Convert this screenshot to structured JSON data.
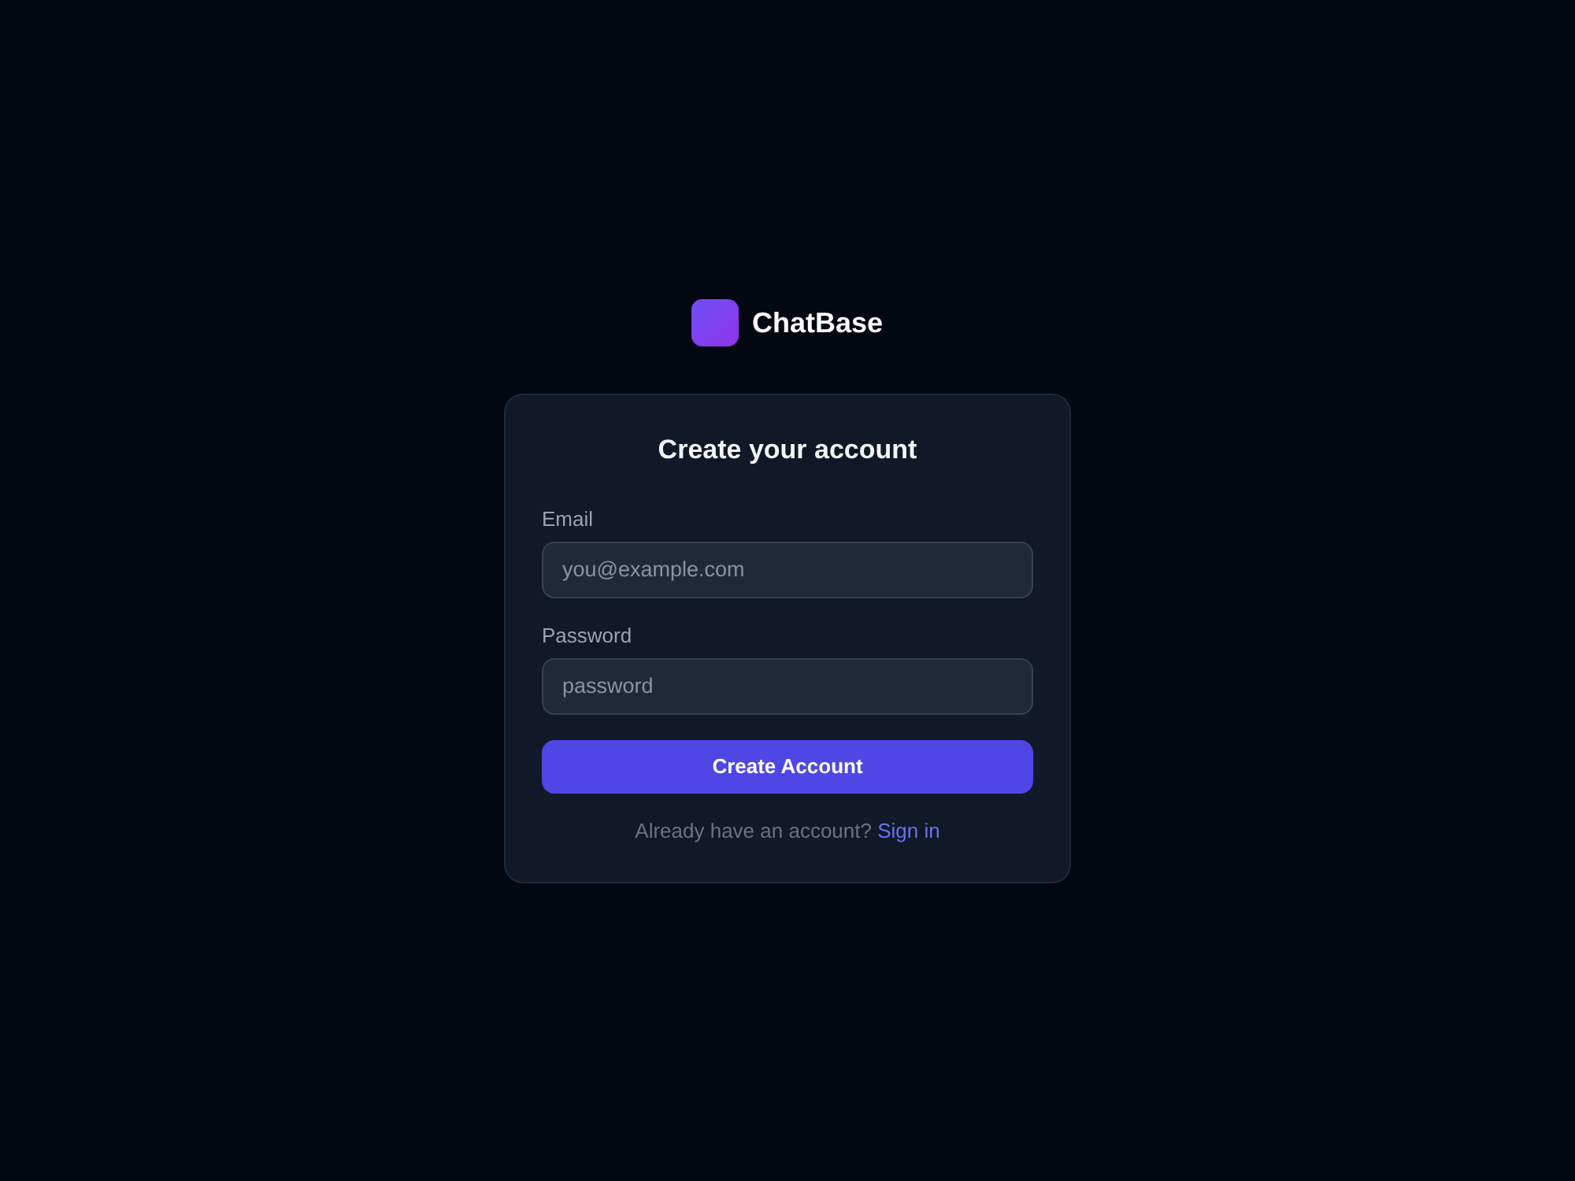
{
  "brand": {
    "name": "ChatBase"
  },
  "card": {
    "title": "Create your account"
  },
  "fields": [
    {
      "label": "Email",
      "placeholder": "you@example.com"
    },
    {
      "label": "Password",
      "placeholder": "password"
    }
  ],
  "submit": {
    "label": "Create Account"
  },
  "footer": {
    "text": "Already have an account?",
    "link": "Sign in"
  }
}
